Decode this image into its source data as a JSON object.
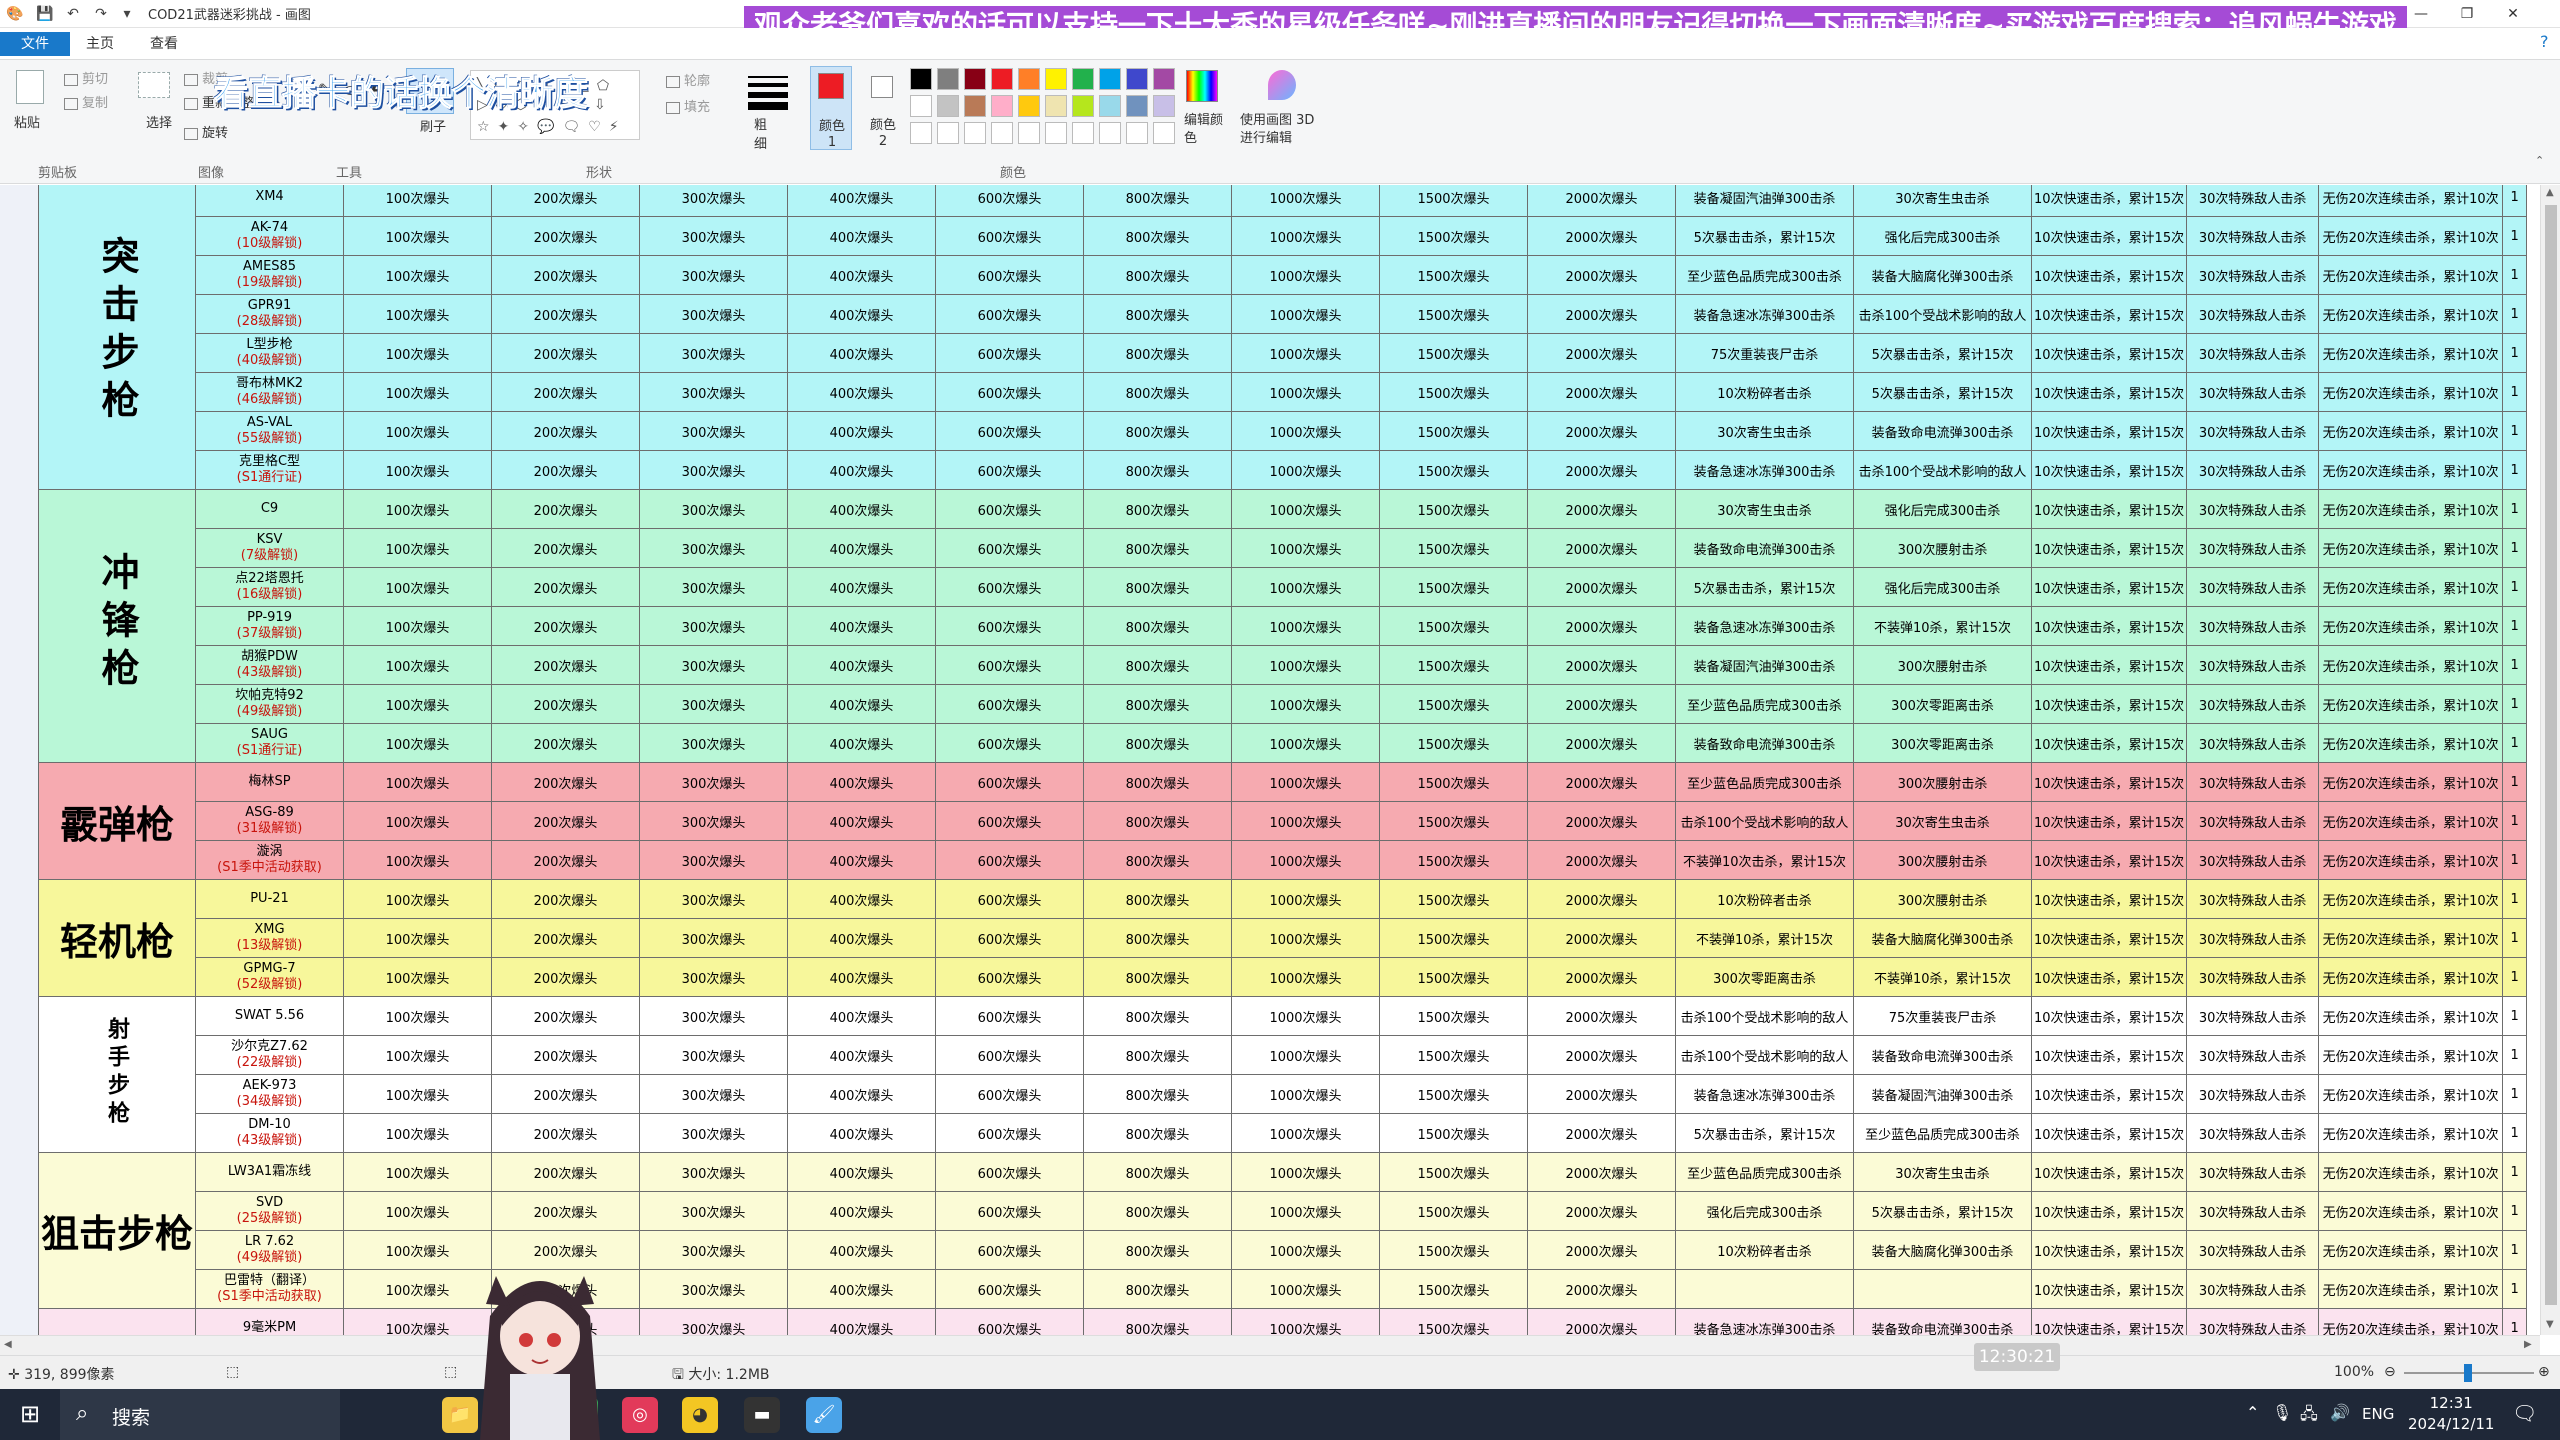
{
  "titlebar": {
    "title": "COD21武器迷彩挑战 - 画图",
    "banner": "观众老爷们喜欢的话可以支持一下十大香的星级任务咩~刚进直播间的朋友记得切换一下画面清晰度~买游戏百度搜索：追风蜗牛游戏"
  },
  "menu": {
    "file": "文件",
    "home": "主页",
    "view": "查看"
  },
  "ribbon": {
    "paste": "粘贴",
    "cut": "剪切",
    "copy": "复制",
    "clipboard": "剪贴板",
    "select": "选择",
    "crop": "裁剪",
    "resize": "重新调整大小",
    "rotate": "旋转",
    "image": "图像",
    "tools": "工具",
    "brush": "刷子",
    "shapes": "形状",
    "outline": "轮廓",
    "fill": "填充",
    "size": "粗细",
    "color1": "颜色 1",
    "color2": "颜色 2",
    "colors": "颜色",
    "edit_colors": "编辑颜色",
    "paint3d": "使用画图 3D 进行编辑",
    "overlay": "看直播卡的话换个清晰度"
  },
  "palette": [
    "#000000",
    "#7f7f7f",
    "#880015",
    "#ed1c24",
    "#ff7f27",
    "#fff200",
    "#22b14c",
    "#00a2e8",
    "#3f48cc",
    "#a349a4",
    "#ffffff",
    "#c3c3c3",
    "#b97a57",
    "#ffaec9",
    "#ffc90e",
    "#efe4b0",
    "#b5e61d",
    "#99d9ea",
    "#7092be",
    "#c8bfe7"
  ],
  "table": {
    "columns": [
      "100次爆头",
      "200次爆头",
      "300次爆头",
      "400次爆头",
      "600次爆头",
      "800次爆头",
      "1000次爆头",
      "1500次爆头",
      "2000次爆头"
    ],
    "tail": {
      "fast": "10次快速击杀，累计15次",
      "special": "30次特殊敌人击杀",
      "streak": "无伤20次连续击杀，累计10次",
      "edge": "1"
    },
    "categories": [
      {
        "name": "突击步枪",
        "style": "vertical",
        "color": "#b3f5f7",
        "rows": [
          {
            "name": "XM4",
            "unlock": "",
            "c1": "装备凝固汽油弹300击杀",
            "c2": "30次寄生虫击杀"
          },
          {
            "name": "AK-74",
            "unlock": "(10级解锁)",
            "c1": "5次暴击击杀，累计15次",
            "c2": "强化后完成300击杀"
          },
          {
            "name": "AMES85",
            "unlock": "(19级解锁)",
            "c1": "至少蓝色品质完成300击杀",
            "c2": "装备大脑腐化弹300击杀"
          },
          {
            "name": "GPR91",
            "unlock": "(28级解锁)",
            "c1": "装备急速冰冻弹300击杀",
            "c2": "击杀100个受战术影响的敌人"
          },
          {
            "name": "L型步枪",
            "unlock": "(40级解锁)",
            "c1": "75次重装丧尸击杀",
            "c2": "5次暴击击杀，累计15次"
          },
          {
            "name": "哥布林MK2",
            "unlock": "(46级解锁)",
            "c1": "10次粉碎者击杀",
            "c2": "5次暴击击杀，累计15次"
          },
          {
            "name": "AS-VAL",
            "unlock": "(55级解锁)",
            "c1": "30次寄生虫击杀",
            "c2": "装备致命电流弹300击杀"
          },
          {
            "name": "克里格C型",
            "unlock": "(S1通行证)",
            "c1": "装备急速冰冻弹300击杀",
            "c2": "击杀100个受战术影响的敌人"
          }
        ]
      },
      {
        "name": "冲锋枪",
        "style": "vertical",
        "color": "#b9f7d7",
        "rows": [
          {
            "name": "C9",
            "unlock": "",
            "c1": "30次寄生虫击杀",
            "c2": "强化后完成300击杀"
          },
          {
            "name": "KSV",
            "unlock": "(7级解锁)",
            "c1": "装备致命电流弹300击杀",
            "c2": "300次腰射击杀"
          },
          {
            "name": "点22塔恩托",
            "unlock": "(16级解锁)",
            "c1": "5次暴击击杀，累计15次",
            "c2": "强化后完成300击杀"
          },
          {
            "name": "PP-919",
            "unlock": "(37级解锁)",
            "c1": "装备急速冰冻弹300击杀",
            "c2": "不装弹10杀，累计15次"
          },
          {
            "name": "胡猴PDW",
            "unlock": "(43级解锁)",
            "c1": "装备凝固汽油弹300击杀",
            "c2": "300次腰射击杀"
          },
          {
            "name": "坎帕克特92",
            "unlock": "(49级解锁)",
            "c1": "至少蓝色品质完成300击杀",
            "c2": "300次零距离击杀"
          },
          {
            "name": "SAUG",
            "unlock": "(S1通行证)",
            "c1": "装备致命电流弹300击杀",
            "c2": "300次零距离击杀"
          }
        ]
      },
      {
        "name": "霰弹枪",
        "style": "horiz",
        "color": "#f6aab0",
        "rows": [
          {
            "name": "梅林SP",
            "unlock": "",
            "c1": "至少蓝色品质完成300击杀",
            "c2": "300次腰射击杀"
          },
          {
            "name": "ASG-89",
            "unlock": "(31级解锁)",
            "c1": "击杀100个受战术影响的敌人",
            "c2": "30次寄生虫击杀"
          },
          {
            "name": "漩涡",
            "unlock": "(S1季中活动获取)",
            "c1": "不装弹10次击杀，累计15次",
            "c2": "300次腰射击杀"
          }
        ]
      },
      {
        "name": "轻机枪",
        "style": "horiz",
        "color": "#f7f79b",
        "rows": [
          {
            "name": "PU-21",
            "unlock": "",
            "c1": "10次粉碎者击杀",
            "c2": "300次腰射击杀"
          },
          {
            "name": "XMG",
            "unlock": "(13级解锁)",
            "c1": "不装弹10杀，累计15次",
            "c2": "装备大脑腐化弹300击杀"
          },
          {
            "name": "GPMG-7",
            "unlock": "(52级解锁)",
            "c1": "300次零距离击杀",
            "c2": "不装弹10杀，累计15次"
          }
        ]
      },
      {
        "name": "射手步枪",
        "style": "small",
        "color": "#ffffff",
        "rows": [
          {
            "name": "SWAT 5.56",
            "unlock": "",
            "c1": "击杀100个受战术影响的敌人",
            "c2": "75次重装丧尸击杀"
          },
          {
            "name": "沙尔克Z7.62",
            "unlock": "(22级解锁)",
            "c1": "击杀100个受战术影响的敌人",
            "c2": "装备致命电流弹300击杀"
          },
          {
            "name": "AEK-973",
            "unlock": "(34级解锁)",
            "c1": "装备急速冰冻弹300击杀",
            "c2": "装备凝固汽油弹300击杀"
          },
          {
            "name": "DM-10",
            "unlock": "(43级解锁)",
            "c1": "5次暴击击杀，累计15次",
            "c2": "至少蓝色品质完成300击杀"
          }
        ]
      },
      {
        "name": "狙击步枪",
        "style": "horiz",
        "color": "#fbfbd6",
        "rows": [
          {
            "name": "LW3A1霜冻线",
            "unlock": "",
            "c1": "至少蓝色品质完成300击杀",
            "c2": "30次寄生虫击杀"
          },
          {
            "name": "SVD",
            "unlock": "(25级解锁)",
            "c1": "强化后完成300击杀",
            "c2": "5次暴击击杀，累计15次"
          },
          {
            "name": "LR 7.62",
            "unlock": "(49级解锁)",
            "c1": "10次粉碎者击杀",
            "c2": "装备大脑腐化弹300击杀"
          },
          {
            "name": "巴雷特（翻译）",
            "unlock": "(S1季中活动获取)",
            "c1": "",
            "c2": ""
          }
        ]
      },
      {
        "name": "",
        "style": "horiz",
        "color": "#fbe3ef",
        "rows": [
          {
            "name": "9毫米PM",
            "unlock": "",
            "c1": "装备急速冰冻弹300击杀",
            "c2": "装备致命电流弹300击杀"
          }
        ]
      }
    ]
  },
  "status": {
    "coords": "319, 899像素",
    "filesize": "大小: 1.2MB",
    "zoom": "100%",
    "timestamp": "12:30:21"
  },
  "taskbar": {
    "search": "搜索",
    "lang": "ENG",
    "time": "12:31",
    "date": "2024/12/11"
  }
}
